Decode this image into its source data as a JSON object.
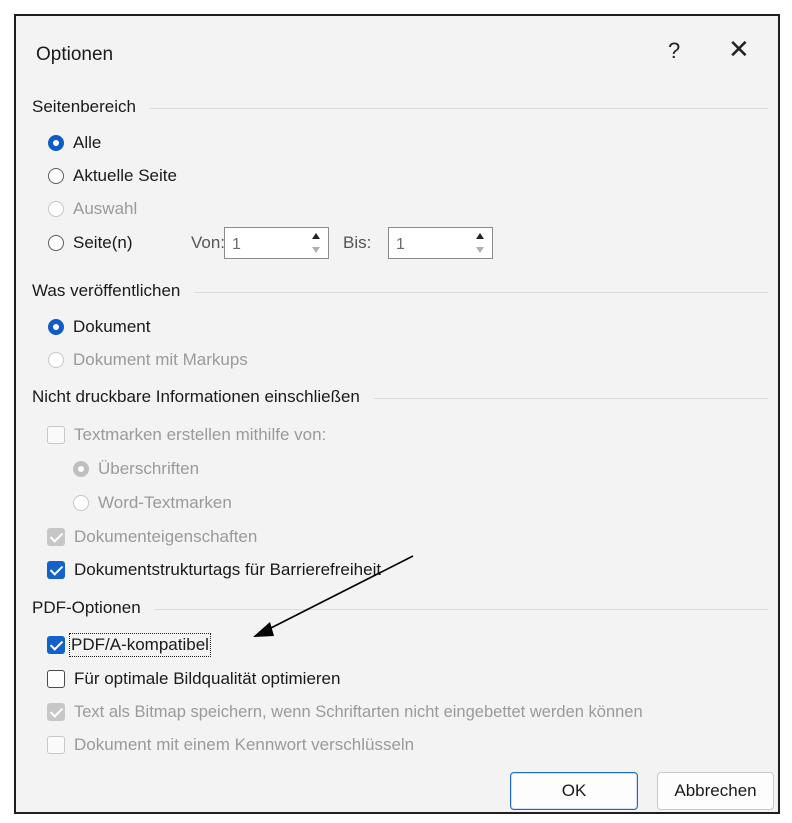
{
  "dialog": {
    "title": "Optionen",
    "help": "?",
    "close": "✕"
  },
  "seitenbereich": {
    "label": "Seitenbereich",
    "alle": "Alle",
    "aktuelle_seite": "Aktuelle Seite",
    "auswahl": "Auswahl",
    "seiten": "Seite(n)",
    "von_label": "Von:",
    "von_value": "1",
    "bis_label": "Bis:",
    "bis_value": "1",
    "selected": "Alle"
  },
  "was_veroeffentlichen": {
    "label": "Was veröffentlichen",
    "dokument": "Dokument",
    "dokument_markups": "Dokument mit Markups",
    "selected": "Dokument"
  },
  "nicht_druckbar": {
    "label": "Nicht druckbare Informationen einschließen",
    "textmarken": "Textmarken erstellen mithilfe von:",
    "ueberschriften": "Überschriften",
    "word_textmarken": "Word-Textmarken",
    "dokumenteigenschaften": "Dokumenteigenschaften",
    "strukturtags": "Dokumentstrukturtags für Barrierefreiheit"
  },
  "pdf_optionen": {
    "label": "PDF-Optionen",
    "pdfa": "PDF/A-kompatibel",
    "bildqualitaet": "Für optimale Bildqualität optimieren",
    "bitmap": "Text als Bitmap speichern, wenn Schriftarten nicht eingebettet werden können",
    "kennwort": "Dokument mit einem Kennwort verschlüsseln"
  },
  "buttons": {
    "ok": "OK",
    "cancel": "Abbrechen"
  },
  "colors": {
    "accent": "#1262c9",
    "disabled": "#9a9a9a",
    "dialog_bg": "#f3f3f3"
  }
}
